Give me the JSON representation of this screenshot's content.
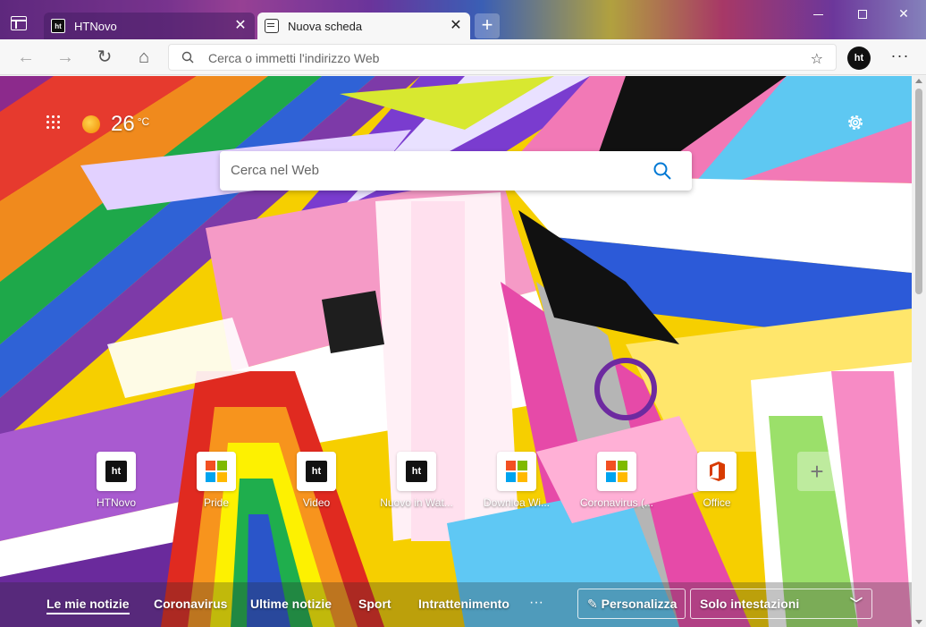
{
  "window": {
    "minimize_label": "",
    "maximize_label": "",
    "close_label": "✕"
  },
  "tabs": [
    {
      "title": "HTNovo",
      "favicon": "ht-logo-icon",
      "active": false
    },
    {
      "title": "Nuova scheda",
      "favicon": "new-tab-icon",
      "active": true
    }
  ],
  "tab_close_glyph": "✕",
  "new_tab_glyph": "+",
  "toolbar": {
    "back_glyph": "←",
    "forward_glyph": "→",
    "refresh_glyph": "↻",
    "home_glyph": "⌂",
    "address_placeholder": "Cerca o immetti l'indirizzo Web",
    "favorites_glyph": "☆",
    "profile_initials": "ht",
    "more_glyph": "···"
  },
  "newtab": {
    "weather": {
      "temperature": "26",
      "unit": "°C"
    },
    "search_placeholder": "Cerca nel Web",
    "quick_links": [
      {
        "label": "HTNovo",
        "icon": "ht-logo-icon"
      },
      {
        "label": "Pride",
        "icon": "microsoft-logo-icon"
      },
      {
        "label": "Video",
        "icon": "ht-logo-icon"
      },
      {
        "label": "Nuovo in Wat...",
        "icon": "ht-logo-icon"
      },
      {
        "label": "Downloa Wi...",
        "icon": "microsoft-logo-icon"
      },
      {
        "label": "Coronavirus (...",
        "icon": "microsoft-logo-icon"
      },
      {
        "label": "Office",
        "icon": "office-logo-icon"
      }
    ],
    "add_tile_glyph": "+",
    "news_tabs": [
      "Le mie notizie",
      "Coronavirus",
      "Ultime notizie",
      "Sport",
      "Intrattenimento"
    ],
    "news_more": "···",
    "personalize_label": "Personalizza",
    "personalize_glyph": "✎",
    "layout_label": "Solo intestazioni",
    "layout_chevron": "﹀"
  },
  "colors": {
    "accent": "#0078d4",
    "ht_brand": "#111111",
    "ms_red": "#f25022",
    "ms_green": "#7fba00",
    "ms_blue": "#00a4ef",
    "ms_yellow": "#ffb900",
    "office_orange": "#d83b01"
  }
}
